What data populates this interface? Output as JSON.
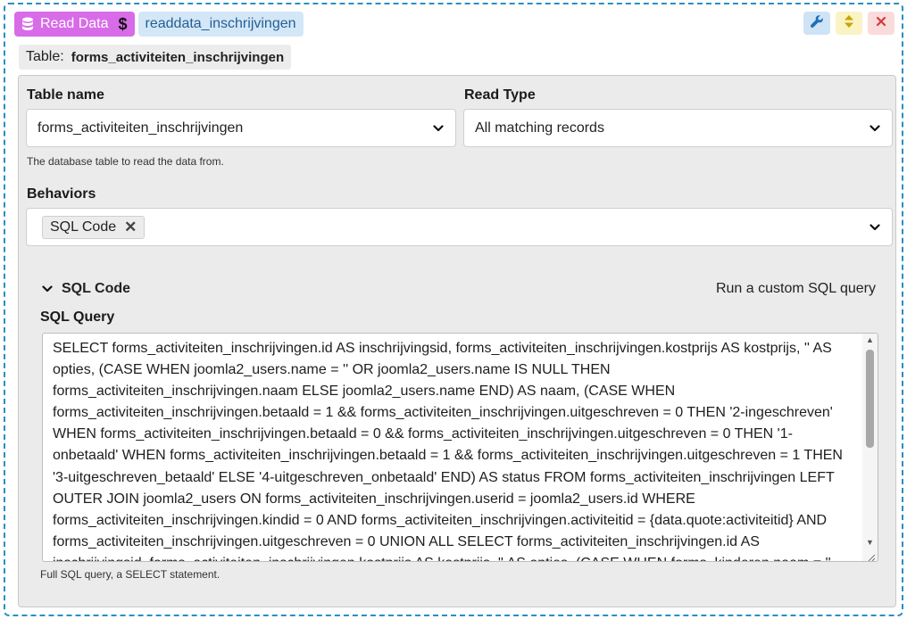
{
  "header": {
    "block_label": "Read Data",
    "block_id": "readdata_inschrijvingen",
    "colors": {
      "block_bg": "#d86ce8",
      "id_bg": "#d4e7f7",
      "border": "#2a8fc0"
    }
  },
  "table_badge": {
    "label": "Table:",
    "value": "forms_activiteiten_inschrijvingen"
  },
  "fields": {
    "table_name": {
      "label": "Table name",
      "value": "forms_activiteiten_inschrijvingen",
      "help": "The database table to read the data from."
    },
    "read_type": {
      "label": "Read Type",
      "value": "All matching records"
    },
    "behaviors": {
      "label": "Behaviors",
      "chips": [
        "SQL Code"
      ]
    }
  },
  "sql_section": {
    "title": "SQL Code",
    "description": "Run a custom SQL query",
    "query_label": "SQL Query",
    "query_value": "SELECT forms_activiteiten_inschrijvingen.id AS inschrijvingsid, forms_activiteiten_inschrijvingen.kostprijs AS kostprijs, '' AS opties, (CASE WHEN joomla2_users.name = '' OR joomla2_users.name IS NULL THEN forms_activiteiten_inschrijvingen.naam ELSE joomla2_users.name END) AS naam, (CASE WHEN forms_activiteiten_inschrijvingen.betaald = 1 && forms_activiteiten_inschrijvingen.uitgeschreven = 0 THEN '2-ingeschreven' WHEN forms_activiteiten_inschrijvingen.betaald = 0 && forms_activiteiten_inschrijvingen.uitgeschreven = 0 THEN '1-onbetaald' WHEN forms_activiteiten_inschrijvingen.betaald = 1 && forms_activiteiten_inschrijvingen.uitgeschreven = 1 THEN '3-uitgeschreven_betaald' ELSE '4-uitgeschreven_onbetaald' END) AS status FROM forms_activiteiten_inschrijvingen LEFT OUTER JOIN joomla2_users ON forms_activiteiten_inschrijvingen.userid = joomla2_users.id WHERE forms_activiteiten_inschrijvingen.kindid = 0 AND forms_activiteiten_inschrijvingen.activiteitid = {data.quote:activiteitid} AND forms_activiteiten_inschrijvingen.uitgeschreven = 0 UNION ALL SELECT forms_activiteiten_inschrijvingen.id AS inschrijvingsid, forms_activiteiten_inschrijvingen.kostprijs AS kostprijs, '' AS opties, (CASE WHEN forms_kinderen.naam = '' OR forms_kinderen.naam IS NULL THEN",
    "help": "Full SQL query, a SELECT statement."
  }
}
